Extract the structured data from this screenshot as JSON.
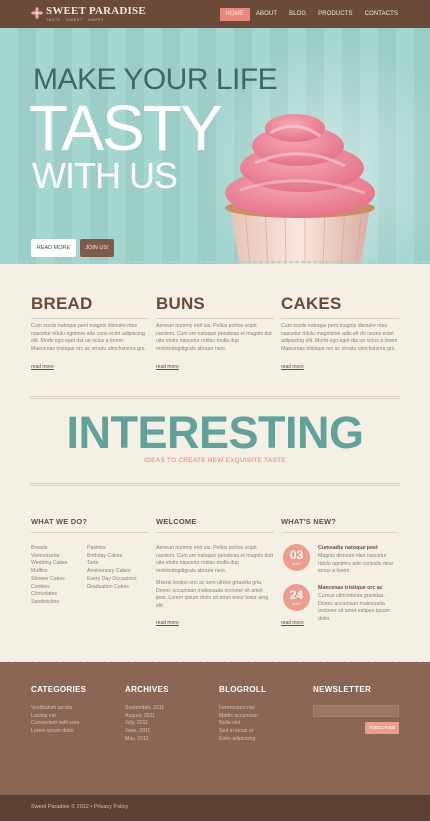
{
  "header": {
    "logo_title": "SWEET PARADISE",
    "logo_subtitle": "TASTE · SWEET · HAPPY",
    "nav": [
      "HOME",
      "ABOUT",
      "BLOG",
      "PRODUCTS",
      "CONTACTS"
    ],
    "active_nav": "HOME"
  },
  "hero": {
    "line1": "MAKE YOUR LIFE",
    "line2": "TASTY",
    "line3": "WITH US",
    "read_more": "READ MORE",
    "join": "JOIN US!"
  },
  "columns": [
    {
      "title": "BREAD",
      "text": "Cum sociis natoque pent magnis disnuire ntes nascetur ridulu ognimre ade cons ectet adipiscing elit. Morbi ego eget dia ue ocius a lorem. Maecenas tristique orc ac ornatu ulmchstsnra grs.",
      "link": "read more"
    },
    {
      "title": "BUNS",
      "text": "Aenean nummy enit uis. Pellus portoo scipit nauismi. Cum sm natoque penatoas et magnis dut uito etoits nascetur rodisu mulla dup molotodegdigrats aboure neoi.",
      "link": "read more"
    },
    {
      "title": "CAKES",
      "text": "Cum sociis natoque pent magnis disnuire ntes nascetur ridulu magnisrier adis elt do ceons ectet adipiscing elit. Morbi ego eget dia ue ocius a lorem. Maecenas tristique orc ac ornatu ulmchstsnra grs.",
      "link": "read more"
    }
  ],
  "interesting": {
    "title": "INTERESTING",
    "subtitle": "IDEAS TO CREATE NEW EXQUISITE TASTE"
  },
  "what_we_do": {
    "title": "WHAT WE DO?",
    "list_a": [
      "Breads",
      "Viennoiserie",
      "Wedding Cakes",
      "Muffins",
      "Shower Cakes",
      "Cookies",
      "Chocolates",
      "Sandwiches"
    ],
    "list_b": [
      "Pastries",
      "Birthday Cakes",
      "Tarts",
      "Anniversary Cakes",
      "Every Day Occasions",
      "Graduation Cakes"
    ]
  },
  "welcome": {
    "title": "WELCOME",
    "para1": "Aenean nummy enit uis. Pellus portoo scipit nauismi. Cum sm natoque penatoas et magnis dutt uito etoits nascetur rodisu mulla dup molotodegdigrats aboure neoi.",
    "para2": "Mserai lesitos orci ac sem ultrice grtavida gria. Donec accumsan malesuada orcioner sit amet ipos. Lorem ipsum dolor sit amet tesur tesur aing elit.",
    "link": "read more"
  },
  "whats_new": {
    "title": "WHAT'S NEW?",
    "items": [
      {
        "day": "03",
        "month": "JULY",
        "title": "Cumsadis natoque peet",
        "text": "Magnis disnuire nles nascetur ridulu ognimre ade contsdis deur ecrus a lorem."
      },
      {
        "day": "24",
        "month": "JULY",
        "title": "Maecenas tristique orc ac",
        "text": "Cursus ultricmlenta gravidas. Donec accumsan malesuada orcioner sit amet estipen ipsum dolor."
      }
    ],
    "link": "read more"
  },
  "footer": {
    "categories": {
      "title": "CATEGORIES",
      "items": [
        "Vestibulum iaculis",
        "Lacinia est",
        "Consectem velit sora",
        "Lorem ipsum dolor"
      ]
    },
    "archives": {
      "title": "ARCHIVES",
      "items": [
        "September, 2011",
        "August, 2011",
        "July, 2011",
        "June, 2011",
        "May, 2011"
      ]
    },
    "blogroll": {
      "title": "BLOGROLL",
      "items": [
        "Fermentum nisl",
        "Mattis accumsan",
        "Nulla nisl",
        "Sed in lacus ut",
        "Enim adipiscing"
      ]
    },
    "newsletter": {
      "title": "NEWSLETTER",
      "button": "SUBSCRIBE",
      "input_value": ""
    },
    "copyright": "Sweet Paradise © 2012 • Privacy Policy"
  },
  "colors": {
    "header_brown": "#6b4a3a",
    "accent_salmon": "#e9897d",
    "teal": "#62a29a",
    "hero_bg": "#a6d6d0",
    "footer_brown": "#8b6654"
  }
}
